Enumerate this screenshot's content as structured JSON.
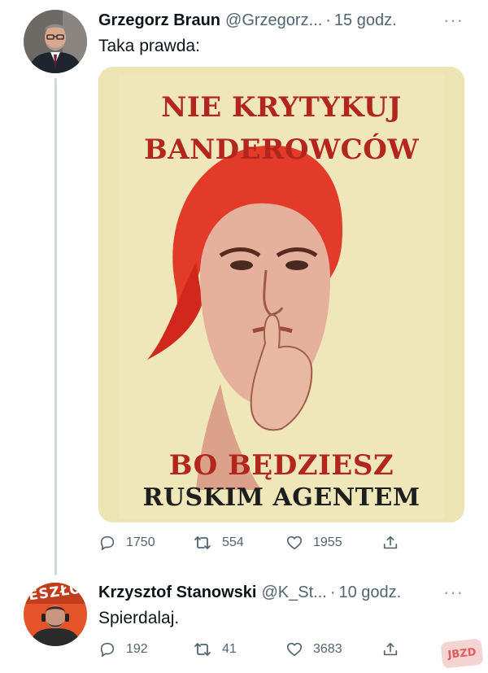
{
  "tweet1": {
    "author_name": "Grzegorz Braun",
    "handle": "@Grzegorz...",
    "separator": "·",
    "time": "15 godz.",
    "more": "···",
    "text": "Taka prawda:",
    "media": {
      "line1": "NIE KRYTYKUJ",
      "line2": "BANDEROWCÓW",
      "line3": "BO BĘDZIESZ",
      "line4": "RUSKIM AGENTEM"
    },
    "actions": {
      "replies": "1750",
      "retweets": "554",
      "likes": "1955"
    }
  },
  "tweet2": {
    "author_name": "Krzysztof Stanowski",
    "handle": "@K_St...",
    "separator": "·",
    "time": "10 godz.",
    "more": "···",
    "avatar_text": "ESZŁO",
    "text": "Spierdalaj.",
    "actions": {
      "replies": "192",
      "retweets": "41",
      "likes": "3683"
    }
  },
  "watermark": "JBZD",
  "colors": {
    "poster_red": "#b3261e",
    "poster_bg": "#ece4b3",
    "text_gray": "#536471",
    "thread_line": "#cfd9de"
  }
}
